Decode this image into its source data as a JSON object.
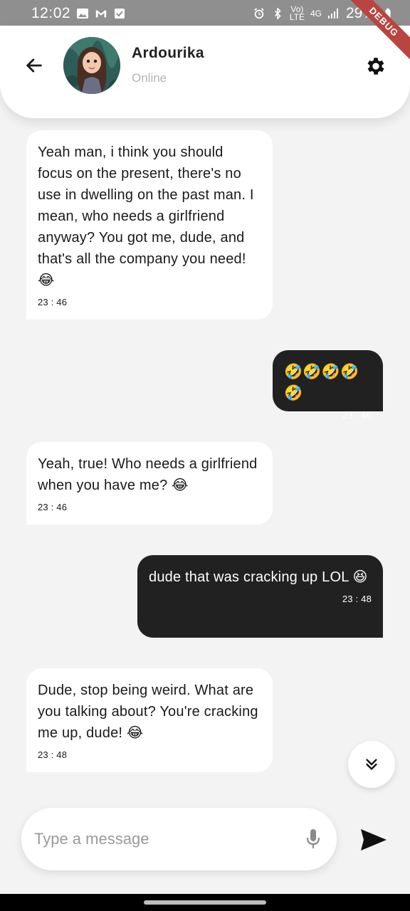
{
  "status_bar": {
    "time": "12:02",
    "network_top": "Vo)",
    "network_bottom": "LTE",
    "signal_type": "4G",
    "battery": "29%",
    "debug_label": "DEBUG"
  },
  "header": {
    "contact_name": "Ardourika",
    "contact_status": "Online"
  },
  "messages": [
    {
      "direction": "in",
      "text": "Yeah man, i think you should focus on the present, there's no use in dwelling on the past man. I mean, who needs a girlfriend anyway? You got me, dude, and that's all the company you need! 😂",
      "time": "23 : 46"
    },
    {
      "direction": "out",
      "text": "🤣🤣🤣🤣🤣",
      "time": "23 : 46"
    },
    {
      "direction": "in",
      "text": " Yeah, true! Who needs a girlfriend when you have me? 😂",
      "time": "23 : 46"
    },
    {
      "direction": "out",
      "text": "dude that was cracking up LOL 😆",
      "time": "23 : 48"
    },
    {
      "direction": "in",
      "text": "Dude, stop being weird. What are you talking about? You're cracking me up, dude! 😂",
      "time": "23 : 48"
    }
  ],
  "composer": {
    "placeholder": "Type a message",
    "value": ""
  },
  "icons": {
    "back": "arrow-left-icon",
    "settings": "gear-icon",
    "scroll_down": "double-chevron-down-icon",
    "mic": "microphone-icon",
    "send": "send-icon"
  },
  "colors": {
    "incoming_bubble": "#ffffff",
    "outgoing_bubble": "#212121",
    "background": "#f3f3f3"
  }
}
